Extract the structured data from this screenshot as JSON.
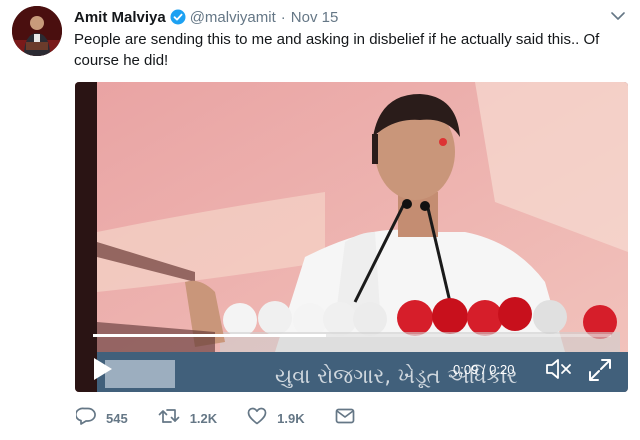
{
  "tweet": {
    "display_name": "Amit Malviya",
    "handle": "@malviyamit",
    "separator": "·",
    "date": "Nov 15",
    "text": "People are sending this to me and asking in disbelief if he actually said this.. Of course he did!",
    "verified_icon": "verified-badge-icon",
    "menu_icon": "chevron-down-icon",
    "accent_color": "#1da1f2"
  },
  "video": {
    "current_time": "0:09",
    "duration": "0:20",
    "time_display": "0:09 / 0:20",
    "progress": 0.45,
    "banner_text": "યુવા રોજગાર, ખેડૂત અધિકાર",
    "controls": [
      "play-icon",
      "volume-muted-icon",
      "fullscreen-icon"
    ]
  },
  "actions": {
    "reply_count": "545",
    "retweet_count": "1.2K",
    "like_count": "1.9K",
    "icons": [
      "reply-icon",
      "retweet-icon",
      "like-icon",
      "message-icon"
    ]
  }
}
